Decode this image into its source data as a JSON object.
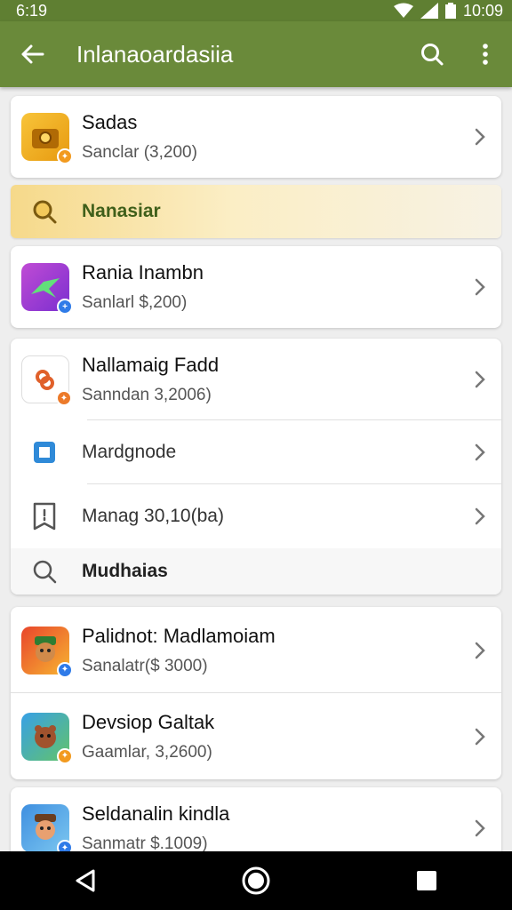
{
  "status_bar": {
    "time": "6:19",
    "clock": "10:09"
  },
  "app_bar": {
    "title": "Inlanaoardasiia"
  },
  "items": [
    {
      "title": "Sadas",
      "subtitle": "Sanclar (3,200)"
    },
    {
      "title": "Rania Inambn",
      "subtitle": "Sanlarl $,200)"
    },
    {
      "title": "Nallamaig Fadd",
      "subtitle": "Sanndan 3,2006)"
    },
    {
      "title": "Palidnot: Madlamoiam",
      "subtitle": "Sanalatr($ 3000)"
    },
    {
      "title": "Devsiop Galtak",
      "subtitle": "Gaamlar, 3,2600)"
    },
    {
      "title": "Seldanalin kindla",
      "subtitle": "Sanmatr $.1009)"
    }
  ],
  "highlight": {
    "label": "Nanasiar"
  },
  "menu_rows": [
    {
      "label": "Mardgnode"
    },
    {
      "label": "Manag 30,10(ba)"
    },
    {
      "label": "Mudhaias"
    }
  ],
  "colors": {
    "app_bar": "#6a8a3a",
    "status_bar": "#5f7f32",
    "highlight": "#f6d98a"
  },
  "icons": {
    "back": "arrow-left-icon",
    "search": "search-icon",
    "menu": "more-vert-icon",
    "chevron": "chevron-right-icon",
    "nav_back": "triangle-back-icon",
    "nav_home": "circle-home-icon",
    "nav_recent": "square-recent-icon"
  }
}
